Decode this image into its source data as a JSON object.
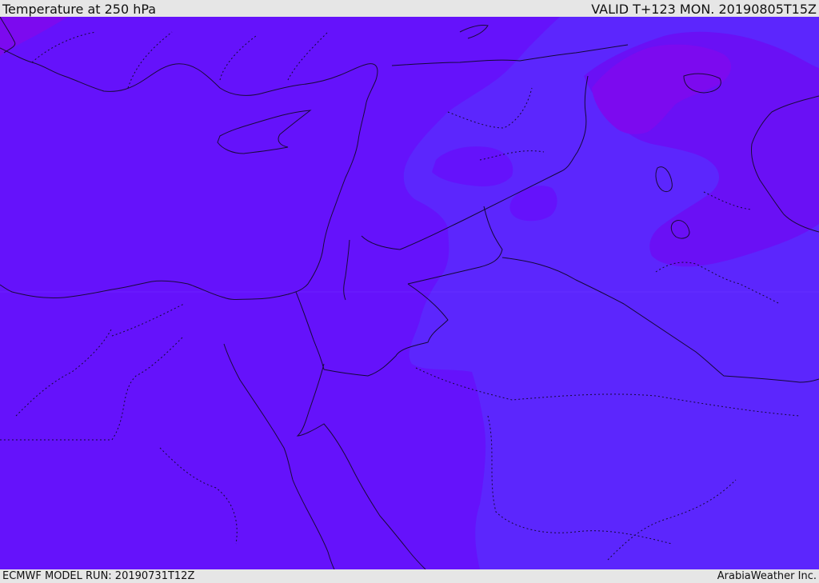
{
  "header": {
    "title": "Temperature at 250 hPa",
    "valid_time": "VALID T+123 MON. 20190805T15Z"
  },
  "footer": {
    "model_run": "ECMWF MODEL RUN: 20190731T12Z",
    "credit": "ArabiaWeather Inc."
  },
  "map": {
    "field": "temperature",
    "level": "250 hPa",
    "colors": {
      "base_field": "#6512fb",
      "cool_band": "#5c26fd",
      "warm_band": "#6a10f5",
      "violet_patch": "#7c0aef",
      "coast_line": "#1a0a3a",
      "border_line": "#140838"
    }
  }
}
